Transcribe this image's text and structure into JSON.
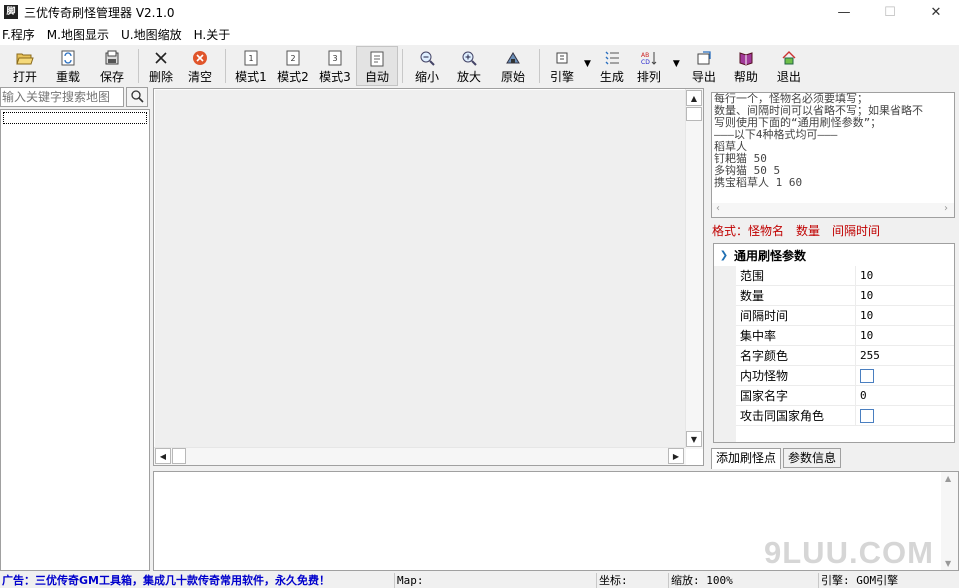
{
  "app": {
    "title": "三优传奇刷怪管理器 V2.1.0",
    "icon_glyph": "脚"
  },
  "window_controls": {
    "minimize": "—",
    "maximize": "☐",
    "close": "✕"
  },
  "menu": [
    {
      "label": "F.程序"
    },
    {
      "label": "M.地图显示"
    },
    {
      "label": "U.地图缩放"
    },
    {
      "label": "H.关于"
    }
  ],
  "toolbar": {
    "open": "打开",
    "reload": "重载",
    "save": "保存",
    "delete": "删除",
    "clear": "清空",
    "mode1": "模式1",
    "mode2": "模式2",
    "mode3": "模式3",
    "auto": "自动",
    "zoom_out": "缩小",
    "zoom_in": "放大",
    "original": "原始",
    "engine": "引擎",
    "generate": "生成",
    "arrange": "排列",
    "export": "导出",
    "help": "帮助",
    "exit": "退出"
  },
  "search": {
    "placeholder": "输入关键字搜索地图"
  },
  "notes": {
    "lines": [
      "每行一个，怪物名必须要填写；",
      "数量、间隔时间可以省略不写；如果省略不",
      "写则使用下面的“通用刷怪参数”；",
      "———以下4种格式均可———",
      "稻草人",
      "钉耙猫 50",
      "多钩猫 50 5",
      "携宝稻草人 1 60"
    ]
  },
  "format_line": "格式：怪物名　数量　间隔时间",
  "params": {
    "header": "通用刷怪参数",
    "rows": [
      {
        "key": "范围",
        "value": "10"
      },
      {
        "key": "数量",
        "value": "10"
      },
      {
        "key": "间隔时间",
        "value": "10"
      },
      {
        "key": "集中率",
        "value": "10"
      },
      {
        "key": "名字颜色",
        "value": "255"
      },
      {
        "key": "内功怪物",
        "value": ""
      },
      {
        "key": "国家名字",
        "value": "0"
      },
      {
        "key": "攻击同国家角色",
        "value": ""
      }
    ]
  },
  "tabs": {
    "add_spawn": "添加刷怪点",
    "param_info": "参数信息"
  },
  "status": {
    "ad": "广告：三优传奇GM工具箱，集成几十款传奇常用软件，永久免费！",
    "map": "Map:",
    "coord": "坐标:",
    "zoom": "缩放: 100%",
    "engine": "引擎: GOM引擎"
  },
  "watermark": "9LUU.COM"
}
